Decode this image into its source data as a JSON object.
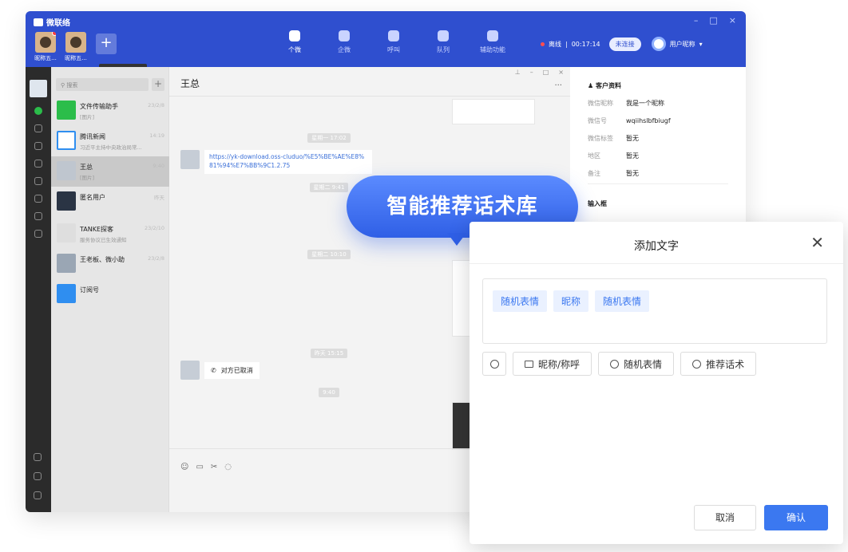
{
  "window": {
    "app_title": "微联络",
    "controls": [
      "–",
      "□",
      "×"
    ]
  },
  "accounts": [
    {
      "label": "昵称五..."
    },
    {
      "label": "昵称五..."
    }
  ],
  "add_account_icon": "+",
  "tooltip": "点击启动微信",
  "nav": [
    {
      "label": "个微",
      "icon": "wechat-icon"
    },
    {
      "label": "企微",
      "icon": "work-wechat-icon"
    },
    {
      "label": "呼叫",
      "icon": "phone-icon"
    },
    {
      "label": "队列",
      "icon": "queue-icon"
    },
    {
      "label": "辅助功能",
      "icon": "layers-icon"
    }
  ],
  "status": {
    "state": "离线",
    "separator": "|",
    "timer": "00:17:14",
    "connect_label": "未连接",
    "username": "用户昵称",
    "chevron": "▾"
  },
  "chat_list": {
    "search_placeholder": "搜索",
    "add_icon": "+",
    "items": [
      {
        "name": "文件传输助手",
        "preview": "[图片]",
        "time": "23/2/8"
      },
      {
        "name": "腾讯新闻",
        "preview": "习近平主持中央政治局常...",
        "time": "14:19"
      },
      {
        "name": "王总",
        "preview": "[图片]",
        "time": "9:40"
      },
      {
        "name": "匿名用户",
        "preview": "",
        "time": "昨天"
      },
      {
        "name": "TANKE探客",
        "preview": "服务协议已生效通知",
        "time": "23/2/10"
      },
      {
        "name": "王老板、微小助",
        "preview": "",
        "time": "23/2/8"
      },
      {
        "name": "订阅号",
        "preview": "",
        "time": ""
      }
    ]
  },
  "conversation": {
    "title": "王总",
    "window_controls": [
      "⊥",
      "–",
      "□",
      "×"
    ],
    "more": "···",
    "timestamps": [
      "星期一 17:02",
      "星期二 9:41",
      "星期二 10:10",
      "昨天 15:15",
      "9:40"
    ],
    "link_text": "https://yk-download.oss-cluduo/%E5%BE%AE%E8%81%94%E7%BB%9C1.2.75",
    "call_text": "对方已取消",
    "tool_icons": [
      "☺",
      "▭",
      "✂",
      "◌"
    ]
  },
  "customer": {
    "header": "客户资料",
    "fields": [
      {
        "key": "微信昵称",
        "value": "我是一个昵称"
      },
      {
        "key": "微信号",
        "value": "wqiihslbfbiugf"
      },
      {
        "key": "微信标签",
        "value": "暂无"
      },
      {
        "key": "地区",
        "value": "暂无"
      },
      {
        "key": "备注",
        "value": "暂无"
      }
    ],
    "input_box_label": "输入框"
  },
  "callout": "智能推荐话术库",
  "dialog": {
    "title": "添加文字",
    "close": "✕",
    "chips": [
      "随机表情",
      "昵称",
      "随机表情"
    ],
    "tools": [
      "昵称/称呼",
      "随机表情",
      "推荐话术"
    ],
    "cancel": "取消",
    "confirm": "确认"
  },
  "colors": {
    "brand": "#2f4fcf",
    "accent": "#3b78f0",
    "chip_bg": "#eaf1ff",
    "offline": "#ff4d4f"
  }
}
